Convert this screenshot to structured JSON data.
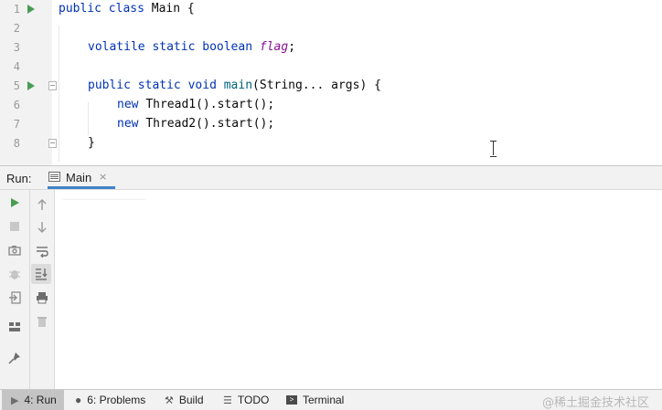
{
  "editor": {
    "lines": [
      {
        "n": "1",
        "text": ""
      },
      {
        "n": "2",
        "text": ""
      },
      {
        "n": "3",
        "text": ""
      },
      {
        "n": "4",
        "text": ""
      },
      {
        "n": "5",
        "text": ""
      },
      {
        "n": "6",
        "text": ""
      },
      {
        "n": "7",
        "text": ""
      },
      {
        "n": "8",
        "text": ""
      }
    ],
    "tokens": {
      "public": "public",
      "class": "class",
      "main_class": "Main",
      "brace_open": " {",
      "volatile": "volatile",
      "static": "static",
      "boolean": "boolean",
      "flag": "flag",
      "semicolon": ";",
      "void": "void",
      "main": "main",
      "params": "(String... args) {",
      "new": "new",
      "thread1": "Thread1().start();",
      "thread2": "Thread2().start();",
      "brace_close": "}"
    }
  },
  "run_window": {
    "label": "Run:",
    "tab_label": "Main",
    "tab_close": "×"
  },
  "bottom_bar": {
    "run": "4: Run",
    "problems": "6: Problems",
    "build": "Build",
    "todo": "TODO",
    "terminal": "Terminal"
  },
  "watermark": "@稀土掘金技术社区",
  "colors": {
    "keyword": "#0033b3",
    "field": "#871094",
    "method": "#00627a",
    "run_green": "#499c54",
    "tab_underline": "#4083c9"
  }
}
